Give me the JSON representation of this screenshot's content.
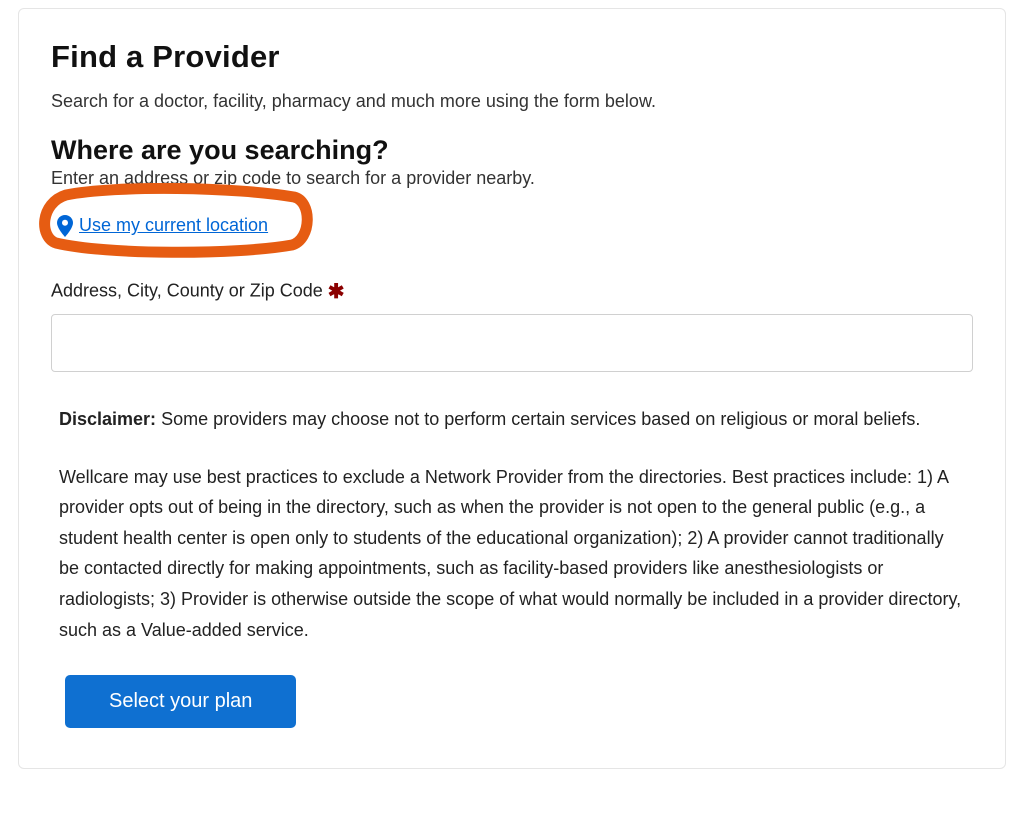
{
  "header": {
    "title": "Find a Provider",
    "subtitle": "Search for a doctor, facility, pharmacy and much more using the form below."
  },
  "location_section": {
    "title": "Where are you searching?",
    "hint": "Enter an address or zip code to search for a provider nearby.",
    "use_location_label": "Use my current location",
    "address_label": "Address, City, County or Zip Code",
    "required_marker": "✱",
    "address_value": ""
  },
  "disclaimer": {
    "label": "Disclaimer:",
    "text1": " Some providers may choose not to perform certain services based on religious or moral beliefs.",
    "text2": "Wellcare may use best practices to exclude a Network Provider from the directories. Best practices include: 1) A provider opts out of being in the directory, such as when the provider is not open to the general public (e.g., a student health center is open only to students of the educational organization); 2) A provider cannot traditionally be contacted directly for making appointments, such as facility-based providers like anesthesiologists or radiologists; 3) Provider is otherwise outside the scope of what would normally be included in a provider directory, such as a Value-added service."
  },
  "cta": {
    "select_plan_label": "Select your plan"
  },
  "colors": {
    "link_blue": "#0066d6",
    "button_blue": "#0f70d1",
    "highlight_orange": "#e65c12",
    "required_red": "#8b0000"
  }
}
